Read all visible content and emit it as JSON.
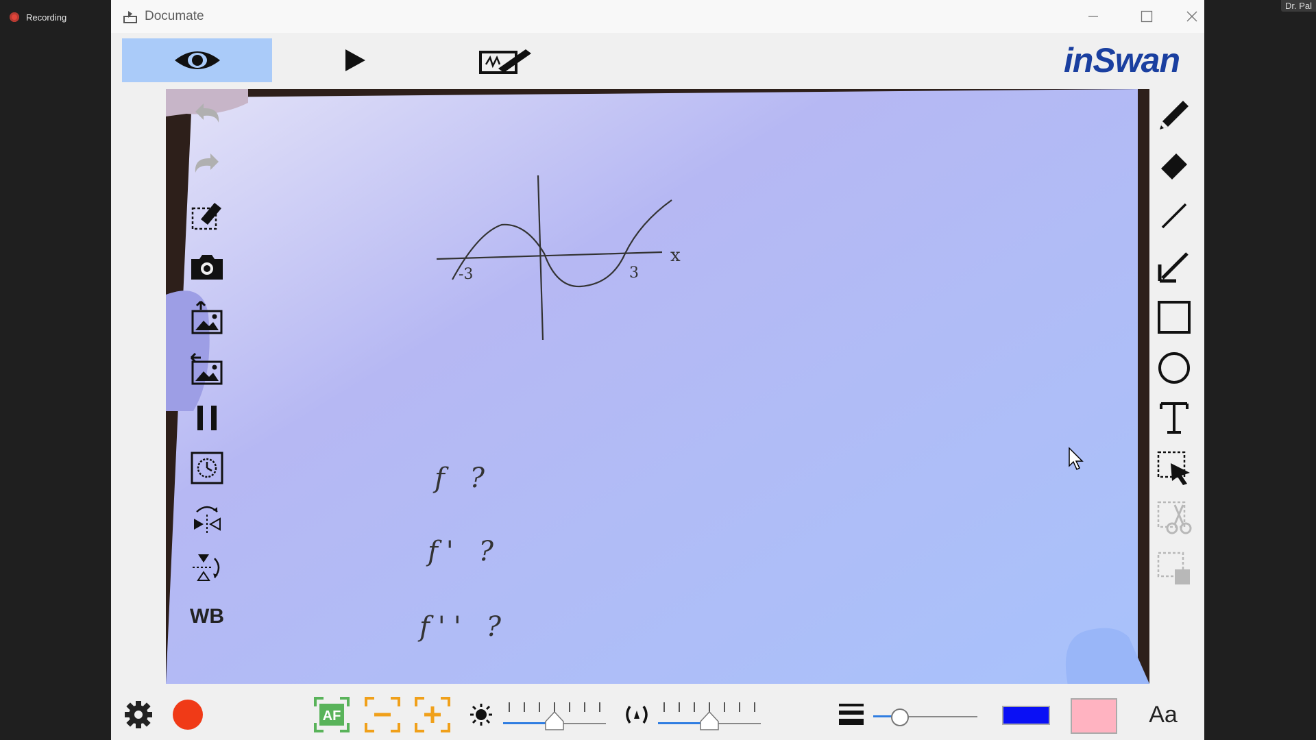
{
  "recording": {
    "label": "Recording"
  },
  "corner_chip": {
    "label": "Dr. Pal"
  },
  "window": {
    "title": "Documate"
  },
  "brand": {
    "logo_text": "inSwan"
  },
  "left_tools": [
    "undo-icon",
    "redo-icon",
    "clear-annotations-icon",
    "camera-icon",
    "import-image-icon",
    "export-image-icon",
    "pause-icon",
    "timer-icon",
    "flip-horizontal-icon",
    "flip-vertical-icon"
  ],
  "left_wb": {
    "label": "WB"
  },
  "right_tools": [
    "pen-icon",
    "eraser-icon",
    "line-icon",
    "arrow-icon",
    "rectangle-icon",
    "circle-icon",
    "text-icon",
    "select-icon",
    "cut-icon",
    "copy-icon"
  ],
  "bottom": {
    "font_label": "Aa",
    "brightness_level": 0.5,
    "exposure_level": 0.5,
    "line_width_level": 0.25,
    "pen_color": "#0a10f5",
    "fill_color": "#ffb3c1",
    "record_color": "#f03a17",
    "focus_color": "#59b35a",
    "zoom_color": "#f0a01a"
  },
  "document": {
    "axis_labels": {
      "x": "x",
      "left": "-3",
      "right": "3"
    },
    "questions": [
      "f ?",
      "f' ?",
      "f'' ?"
    ]
  }
}
